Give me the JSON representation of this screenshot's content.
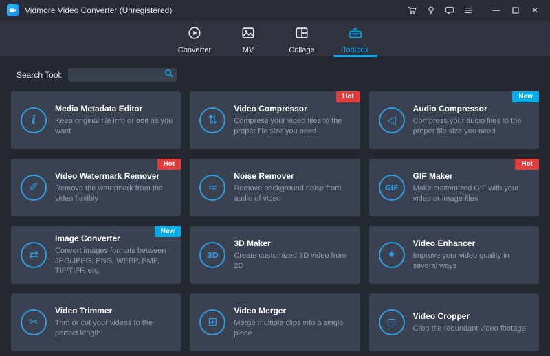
{
  "window": {
    "title": "Vidmore Video Converter (Unregistered)"
  },
  "titlebar": {
    "icons": [
      "cart-icon",
      "lightbulb-icon",
      "feedback-icon",
      "menu-icon"
    ],
    "window_buttons": [
      "minimize-button",
      "maximize-button",
      "close-button"
    ]
  },
  "nav": {
    "tabs": [
      {
        "label": "Converter",
        "icon": "converter-icon",
        "active": false
      },
      {
        "label": "MV",
        "icon": "mv-icon",
        "active": false
      },
      {
        "label": "Collage",
        "icon": "collage-icon",
        "active": false
      },
      {
        "label": "Toolbox",
        "icon": "toolbox-icon",
        "active": true
      }
    ]
  },
  "search": {
    "label": "Search Tool:",
    "placeholder": "",
    "icon": "search-icon"
  },
  "tools": [
    {
      "title": "Media Metadata Editor",
      "desc": "Keep original file info or edit as you want",
      "icon": "info-icon",
      "badge": null
    },
    {
      "title": "Video Compressor",
      "desc": "Compress your video files to the proper file size you need",
      "icon": "compress-icon",
      "badge": "Hot"
    },
    {
      "title": "Audio Compressor",
      "desc": "Compress your audio files to the proper file size you need",
      "icon": "audio-compressor-icon",
      "badge": "New"
    },
    {
      "title": "Video Watermark Remover",
      "desc": "Remove the watermark from the video flexibly",
      "icon": "watermark-remover-icon",
      "badge": "Hot"
    },
    {
      "title": "Noise Remover",
      "desc": "Remove background noise from audio of video",
      "icon": "noise-remover-icon",
      "badge": null
    },
    {
      "title": "GIF Maker",
      "desc": "Make customized GIF with your video or image files",
      "icon": "gif-icon",
      "badge": "Hot"
    },
    {
      "title": "Image Converter",
      "desc": "Convert images formats between JPG/JPEG, PNG, WEBP, BMP, TIF/TIFF, etc.",
      "icon": "image-converter-icon",
      "badge": "New"
    },
    {
      "title": "3D Maker",
      "desc": "Create customized 3D video from 2D",
      "icon": "3d-icon",
      "badge": null
    },
    {
      "title": "Video Enhancer",
      "desc": "Improve your video quality in several ways",
      "icon": "enhancer-icon",
      "badge": null
    },
    {
      "title": "Video Trimmer",
      "desc": "Trim or cut your videos to the perfect length",
      "icon": "scissors-icon",
      "badge": null
    },
    {
      "title": "Video Merger",
      "desc": "Merge multiple clips into a single piece",
      "icon": "merge-icon",
      "badge": null
    },
    {
      "title": "Video Cropper",
      "desc": "Crop the redundant video footage",
      "icon": "crop-icon",
      "badge": null
    }
  ],
  "colors": {
    "accent": "#00a8f0",
    "hot_badge": "#e23c3c",
    "new_badge": "#00aeea",
    "card_bg": "#3a4150",
    "background": "#242830",
    "titlebar_bg": "#272c35",
    "nav_bg": "#2e333d"
  }
}
